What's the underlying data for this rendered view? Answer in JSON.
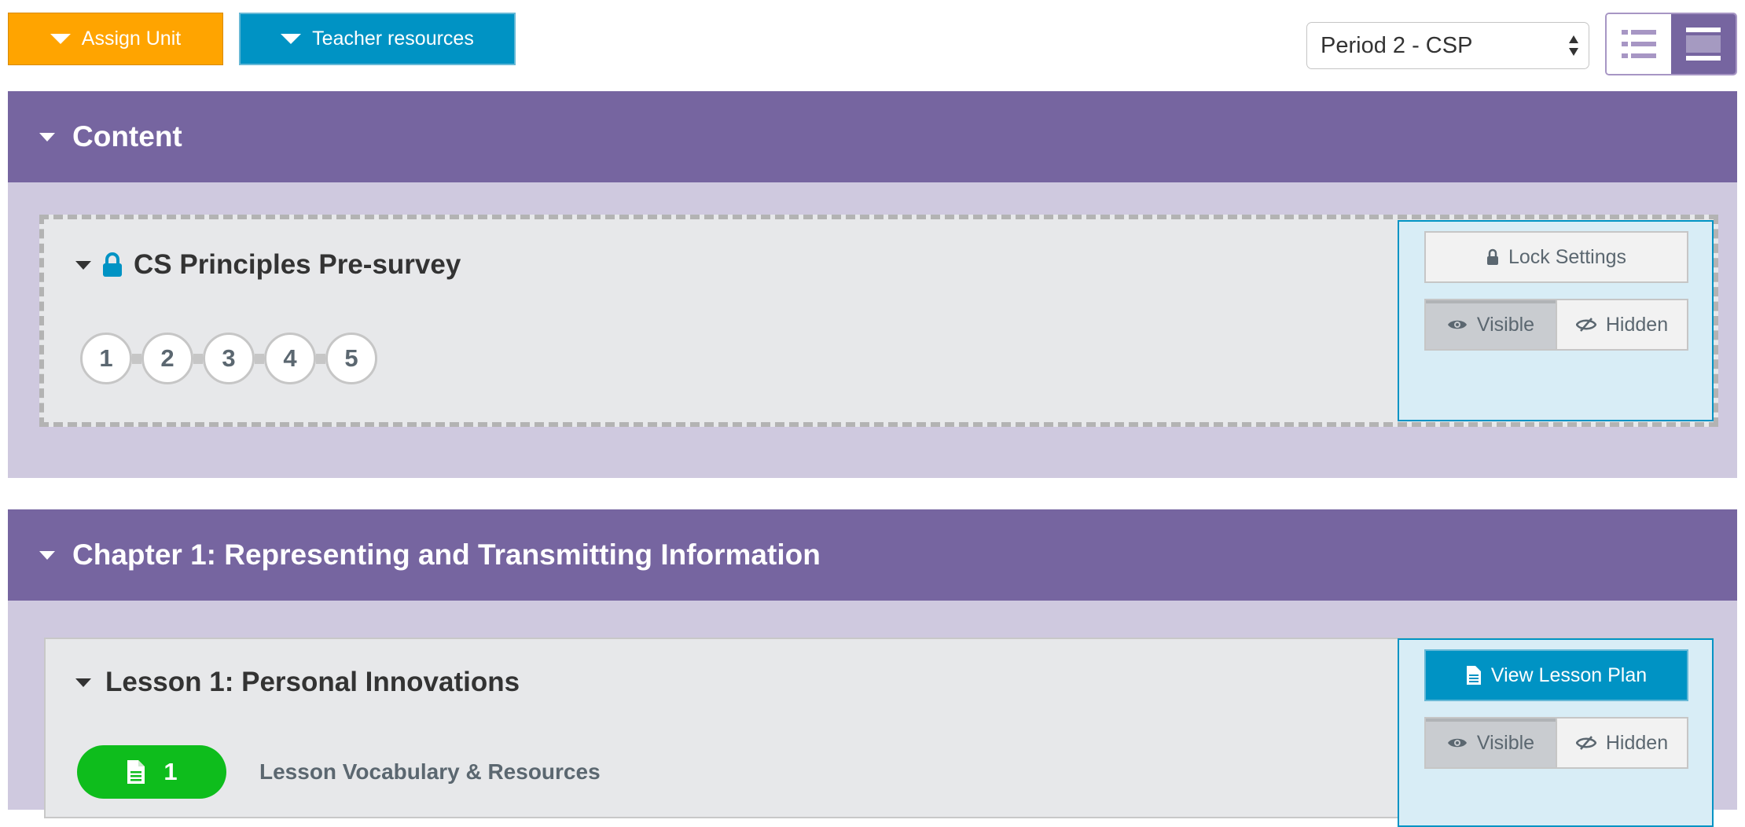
{
  "toolbar": {
    "assign_unit_label": "Assign Unit",
    "teacher_resources_label": "Teacher resources",
    "section_select_value": "Period 2 - CSP"
  },
  "view_toggle": {
    "list_icon": "list-view-icon",
    "detail_icon": "detail-view-icon",
    "active": "detail"
  },
  "colors": {
    "assign_orange": "#ffa400",
    "teacher_blue": "#0093c4",
    "header_purple": "#7665a0",
    "section_bg": "#cfc9df",
    "card_bg": "#e7e8ea",
    "panel_bg": "#d8edf6",
    "level_green": "#0ebd1c"
  },
  "sections": [
    {
      "title": "Content",
      "lesson": {
        "title": "CS Principles Pre-survey",
        "locked": true,
        "levels": [
          "1",
          "2",
          "3",
          "4",
          "5"
        ],
        "primary_button": {
          "icon": "lock-icon",
          "label": "Lock Settings"
        },
        "visibility": {
          "visible_label": "Visible",
          "hidden_label": "Hidden",
          "selected": "Visible"
        }
      }
    },
    {
      "title": "Chapter 1: Representing and Transmitting Information",
      "lesson": {
        "title": "Lesson 1: Personal Innovations",
        "locked": false,
        "level_pill": {
          "icon": "document-icon",
          "number": "1"
        },
        "level_label": "Lesson Vocabulary & Resources",
        "primary_button": {
          "icon": "document-icon",
          "label": "View Lesson Plan"
        },
        "visibility": {
          "visible_label": "Visible",
          "hidden_label": "Hidden",
          "selected": "Visible"
        }
      }
    }
  ]
}
